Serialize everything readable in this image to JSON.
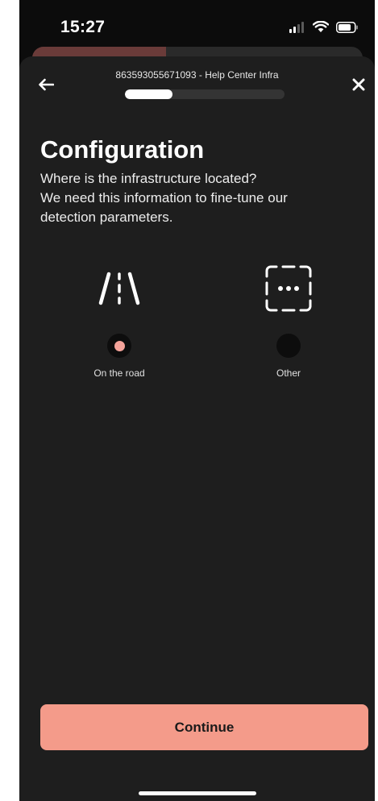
{
  "status_bar": {
    "time": "15:27"
  },
  "header": {
    "title": "863593055671093 - Help Center Infra",
    "progress": 0.3
  },
  "main": {
    "heading": "Configuration",
    "description_lines": [
      "Where is the infrastructure located?",
      "We need this information to fine-tune our",
      "detection parameters."
    ],
    "options": [
      {
        "label": "On the road",
        "icon": "road-icon",
        "selected": true
      },
      {
        "label": "Other",
        "icon": "dots-frame-icon",
        "selected": false
      }
    ]
  },
  "footer": {
    "continue_label": "Continue"
  },
  "colors": {
    "accent": "#f49b8a",
    "radio_selected": "#f4a39a",
    "sheet_bg": "#1e1e1e",
    "page_bg": "#0c0c0c"
  }
}
